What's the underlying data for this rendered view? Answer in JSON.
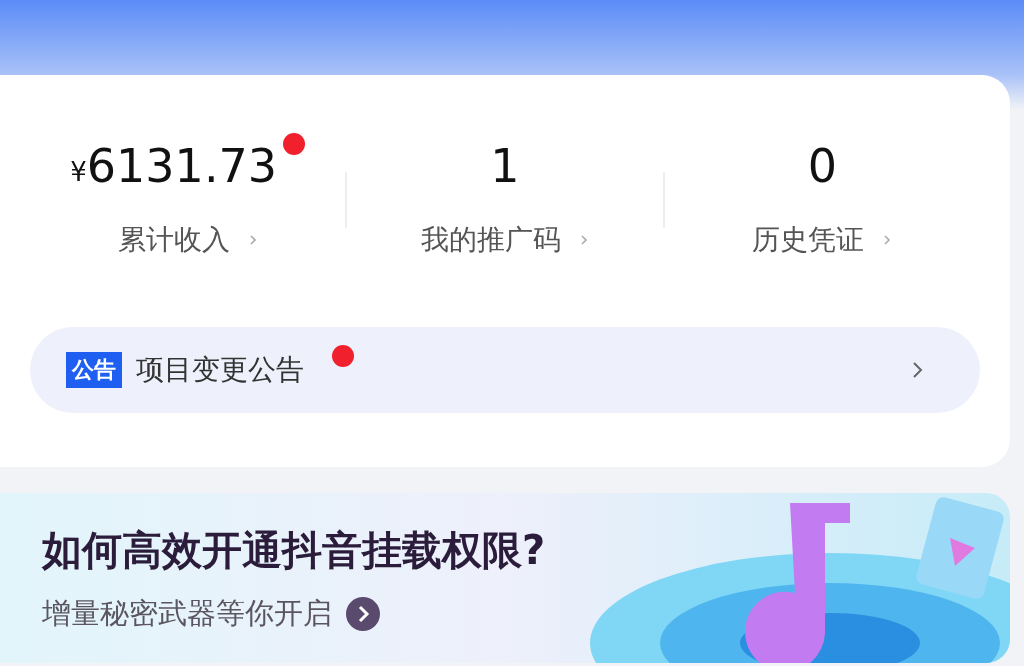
{
  "stats": [
    {
      "value": "6131.73",
      "currency": "¥",
      "label": "累计收入",
      "dot": true
    },
    {
      "value": "1",
      "label": "我的推广码",
      "dot": false
    },
    {
      "value": "0",
      "label": "历史凭证",
      "dot": false
    }
  ],
  "notice": {
    "badge": "公告",
    "text": "项目变更公告",
    "dot": true
  },
  "banner": {
    "title": "如何高效开通抖音挂载权限?",
    "subtitle": "增量秘密武器等你开启"
  }
}
